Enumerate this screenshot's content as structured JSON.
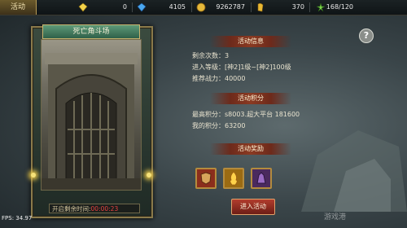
{
  "topbar": {
    "tab_label": "活动",
    "resources": [
      {
        "icon": "diamond-icon",
        "value": "0"
      },
      {
        "icon": "sapphire-icon",
        "value": "4105"
      },
      {
        "icon": "gold-coin-icon",
        "value": "9262787"
      },
      {
        "icon": "gold-bar-icon",
        "value": "370"
      },
      {
        "icon": "stamina-icon",
        "value": "168/120"
      }
    ]
  },
  "card": {
    "title": "死亡角斗场",
    "footer_label": "开启剩余时间:",
    "footer_timer": "00:00:23"
  },
  "panel": {
    "info_title": "活动信息",
    "info_rows": [
      "剩余次数：3",
      "进入等级：[神2]1级~[神2]100级",
      "推荐战力：40000"
    ],
    "score_title": "活动积分",
    "score_rows": [
      "最高积分：s8003.超大平台  181600",
      "我的积分：63200"
    ],
    "reward_title": "活动奖励",
    "rewards": [
      {
        "icon": "armor-item-icon",
        "color": "#8b2e1c"
      },
      {
        "icon": "gold-flame-item-icon",
        "color": "#9b6b12"
      },
      {
        "icon": "purple-beast-item-icon",
        "color": "#4a2a5e"
      }
    ],
    "enter_label": "进入活动",
    "help_label": "?"
  },
  "fps": {
    "label": "FPS:",
    "value": "34.97"
  },
  "watermark": "游戏港"
}
